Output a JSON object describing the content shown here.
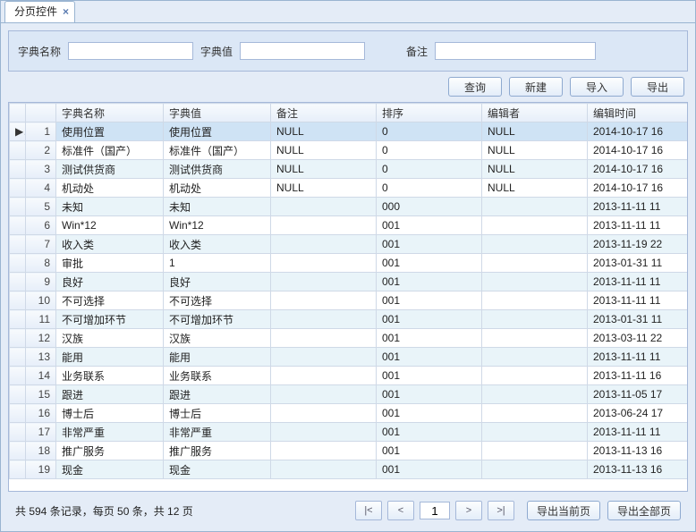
{
  "tab": {
    "title": "分页控件",
    "close": "×"
  },
  "filters": {
    "name_label": "字典名称",
    "value_label": "字典值",
    "remark_label": "备注"
  },
  "buttons": {
    "query": "查询",
    "new": "新建",
    "import": "导入",
    "export": "导出"
  },
  "columns": {
    "name": "字典名称",
    "value": "字典值",
    "remark": "备注",
    "sort": "排序",
    "editor": "编辑者",
    "edittime": "编辑时间"
  },
  "rows": [
    {
      "n": "1",
      "name": "使用位置",
      "value": "使用位置",
      "remark": "NULL",
      "sort": "0",
      "editor": "NULL",
      "time": "2014-10-17 16",
      "sel": true,
      "mark": "▶"
    },
    {
      "n": "2",
      "name": "标准件（国产）",
      "value": "标准件（国产）",
      "remark": "NULL",
      "sort": "0",
      "editor": "NULL",
      "time": "2014-10-17 16"
    },
    {
      "n": "3",
      "name": "测试供货商",
      "value": "测试供货商",
      "remark": "NULL",
      "sort": "0",
      "editor": "NULL",
      "time": "2014-10-17 16"
    },
    {
      "n": "4",
      "name": "机动处",
      "value": "机动处",
      "remark": "NULL",
      "sort": "0",
      "editor": "NULL",
      "time": "2014-10-17 16"
    },
    {
      "n": "5",
      "name": "未知",
      "value": "未知",
      "remark": "",
      "sort": "000",
      "editor": "",
      "time": "2013-11-11 11"
    },
    {
      "n": "6",
      "name": "Win*12",
      "value": "Win*12",
      "remark": "",
      "sort": "001",
      "editor": "",
      "time": "2013-11-11 11"
    },
    {
      "n": "7",
      "name": "收入类",
      "value": "收入类",
      "remark": "",
      "sort": "001",
      "editor": "",
      "time": "2013-11-19 22"
    },
    {
      "n": "8",
      "name": "审批",
      "value": "1",
      "remark": "",
      "sort": "001",
      "editor": "",
      "time": "2013-01-31 11"
    },
    {
      "n": "9",
      "name": "良好",
      "value": "良好",
      "remark": "",
      "sort": "001",
      "editor": "",
      "time": "2013-11-11 11"
    },
    {
      "n": "10",
      "name": "不可选择",
      "value": "不可选择",
      "remark": "",
      "sort": "001",
      "editor": "",
      "time": "2013-11-11 11"
    },
    {
      "n": "11",
      "name": "不可增加环节",
      "value": "不可增加环节",
      "remark": "",
      "sort": "001",
      "editor": "",
      "time": "2013-01-31 11"
    },
    {
      "n": "12",
      "name": "汉族",
      "value": "汉族",
      "remark": "",
      "sort": "001",
      "editor": "",
      "time": "2013-03-11 22"
    },
    {
      "n": "13",
      "name": "能用",
      "value": "能用",
      "remark": "",
      "sort": "001",
      "editor": "",
      "time": "2013-11-11 11"
    },
    {
      "n": "14",
      "name": "业务联系",
      "value": "业务联系",
      "remark": "",
      "sort": "001",
      "editor": "",
      "time": "2013-11-11 16"
    },
    {
      "n": "15",
      "name": "跟进",
      "value": "跟进",
      "remark": "",
      "sort": "001",
      "editor": "",
      "time": "2013-11-05 17"
    },
    {
      "n": "16",
      "name": "博士后",
      "value": "博士后",
      "remark": "",
      "sort": "001",
      "editor": "",
      "time": "2013-06-24 17"
    },
    {
      "n": "17",
      "name": "非常严重",
      "value": "非常严重",
      "remark": "",
      "sort": "001",
      "editor": "",
      "time": "2013-11-11 11"
    },
    {
      "n": "18",
      "name": "推广服务",
      "value": "推广服务",
      "remark": "",
      "sort": "001",
      "editor": "",
      "time": "2013-11-13 16"
    },
    {
      "n": "19",
      "name": "现金",
      "value": "现金",
      "remark": "",
      "sort": "001",
      "editor": "",
      "time": "2013-11-13 16"
    }
  ],
  "footer": {
    "summary": "共 594 条记录，每页 50 条，共 12 页",
    "first": "|<",
    "prev": "<",
    "page": "1",
    "next": ">",
    "last": ">|",
    "export_page": "导出当前页",
    "export_all": "导出全部页"
  }
}
